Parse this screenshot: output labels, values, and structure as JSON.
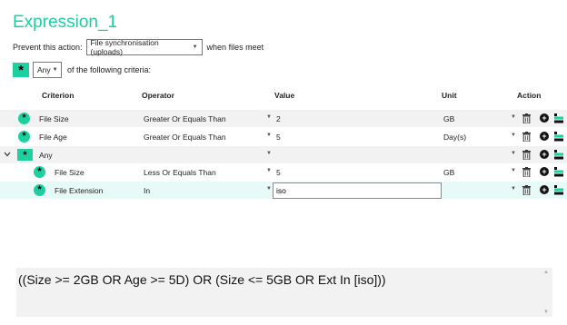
{
  "title": "Expression_1",
  "prevent": {
    "label": "Prevent this action:",
    "action_value": "File synchronisation (uploads)",
    "suffix": "when files meet"
  },
  "criteria_match": {
    "value": "Any",
    "suffix": "of the following criteria:"
  },
  "columns": {
    "criterion": "Criterion",
    "operator": "Operator",
    "value": "Value",
    "unit": "Unit",
    "action": "Action"
  },
  "rows": [
    {
      "criterion": "File Size",
      "operator": "Greater Or Equals Than",
      "value": "2",
      "unit": "GB"
    },
    {
      "criterion": "File Age",
      "operator": "Greater Or Equals Than",
      "value": "5",
      "unit": "Day(s)"
    },
    {
      "criterion": "Any",
      "operator": "",
      "value": "",
      "unit": ""
    },
    {
      "criterion": "File Size",
      "operator": "Less Or Equals Than",
      "value": "5",
      "unit": "GB"
    },
    {
      "criterion": "File Extension",
      "operator": "In",
      "value": "iso",
      "unit": ""
    }
  ],
  "expression": "((Size >= 2GB OR Age >= 5D) OR (Size <= 5GB OR Ext In [iso]))",
  "colors": {
    "accent": "#1ecfa0"
  },
  "icons": [
    "asterisk-icon",
    "expand-chevron-icon",
    "trash-icon",
    "add-icon",
    "add-group-icon",
    "dropdown-caret-icon"
  ]
}
